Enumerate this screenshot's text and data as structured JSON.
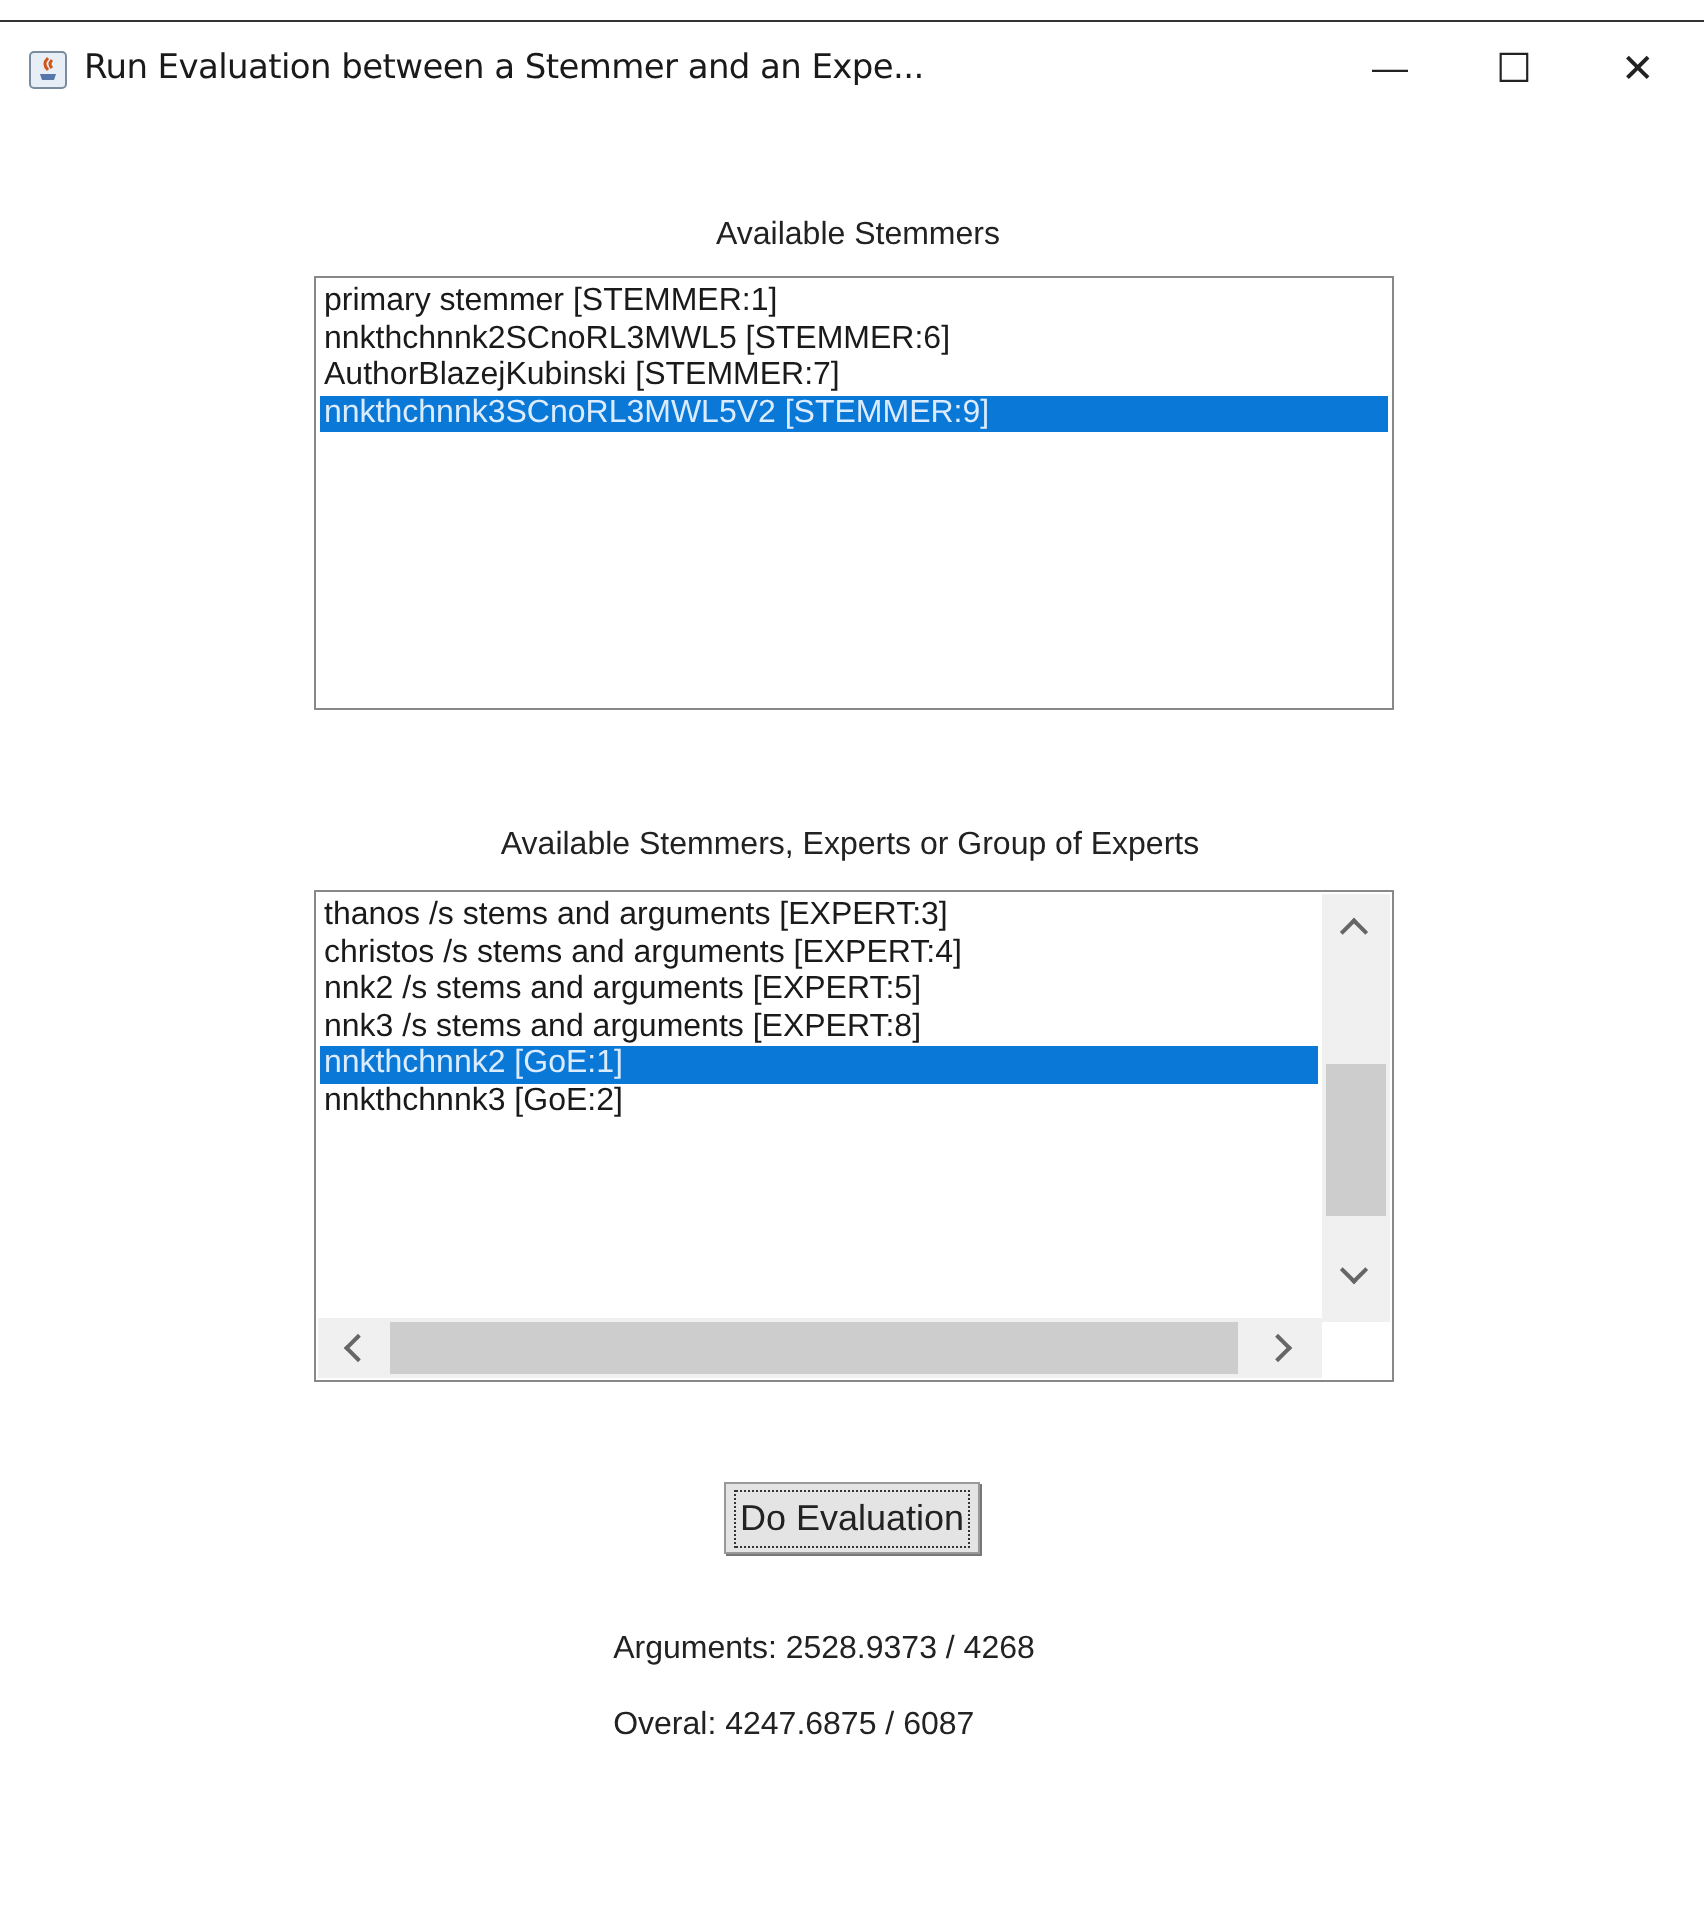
{
  "window": {
    "title": "Run Evaluation between a Stemmer and an Expe...",
    "controls": [
      "—",
      "☐",
      "✕"
    ]
  },
  "stemmers": {
    "label": "Available Stemmers",
    "items": [
      {
        "text": "primary stemmer [STEMMER:1]",
        "selected": false
      },
      {
        "text": "nnkthchnnk2SCnoRL3MWL5 [STEMMER:6]",
        "selected": false
      },
      {
        "text": "AuthorBlazejKubinski [STEMMER:7]",
        "selected": false
      },
      {
        "text": "nnkthchnnk3SCnoRL3MWL5V2 [STEMMER:9]",
        "selected": true
      }
    ]
  },
  "experts": {
    "label": "Available Stemmers, Experts or Group of Experts",
    "items": [
      {
        "text": "thanos /s stems and arguments [EXPERT:3]",
        "selected": false
      },
      {
        "text": "christos /s stems and arguments [EXPERT:4]",
        "selected": false
      },
      {
        "text": "nnk2 /s stems and arguments [EXPERT:5]",
        "selected": false
      },
      {
        "text": "nnk3 /s stems and arguments [EXPERT:8]",
        "selected": false
      },
      {
        "text": "nnkthchnnk2 [GoE:1]",
        "selected": true
      },
      {
        "text": "nnkthchnnk3 [GoE:2]",
        "selected": false
      }
    ]
  },
  "button": "Do Evaluation",
  "results": [
    "Arguments: 2528.9373 / 4268",
    "Overal: 4247.6875 / 6087"
  ]
}
